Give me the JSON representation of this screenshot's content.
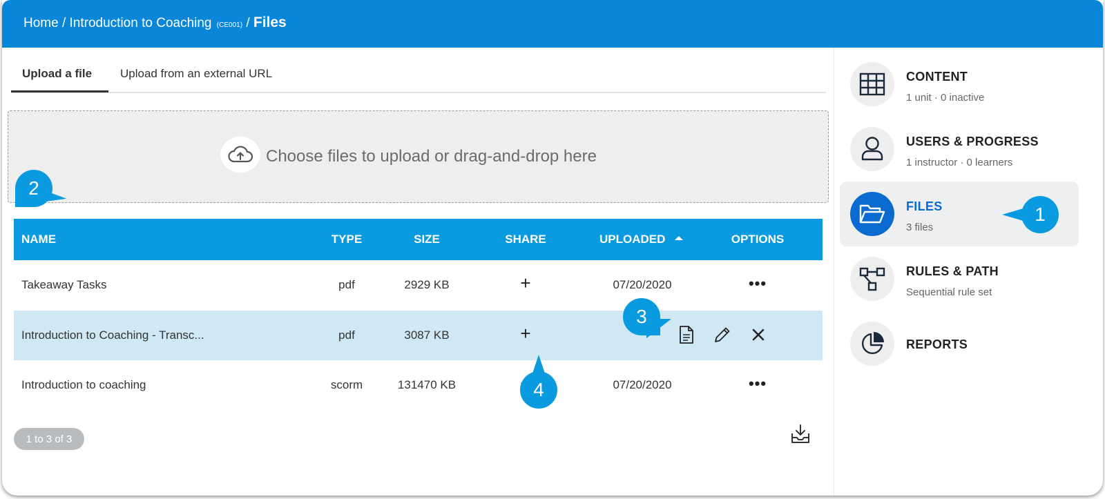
{
  "breadcrumb": {
    "home": "Home",
    "sep1": "/",
    "course": "Introduction to Coaching",
    "code": "(CE001)",
    "sep2": "/",
    "current": "Files"
  },
  "tabs": [
    {
      "label": "Upload a file",
      "active": true
    },
    {
      "label": "Upload from an external URL",
      "active": false
    }
  ],
  "dropzone": {
    "text": "Choose files to upload or drag-and-drop here",
    "icon": "cloud-upload-icon"
  },
  "table": {
    "headers": {
      "name": "NAME",
      "type": "TYPE",
      "size": "SIZE",
      "share": "SHARE",
      "uploaded": "UPLOADED",
      "options": "OPTIONS"
    },
    "sort": {
      "column": "uploaded",
      "direction": "ascending"
    },
    "rows": [
      {
        "name": "Takeaway Tasks",
        "type": "pdf",
        "size": "2929 KB",
        "share": "+",
        "uploaded": "07/20/2020",
        "options": "•••"
      },
      {
        "name": "Introduction to Coaching - Transc...",
        "type": "pdf",
        "size": "3087 KB",
        "share": "+",
        "uploaded": "",
        "options": "",
        "hover_actions": [
          "document-icon",
          "pencil-icon",
          "close-icon"
        ]
      },
      {
        "name": "Introduction to coaching",
        "type": "scorm",
        "size": "131470 KB",
        "share": "+",
        "uploaded": "07/20/2020",
        "options": "•••"
      }
    ],
    "pager": "1 to 3 of 3"
  },
  "sidebar": [
    {
      "title": "CONTENT",
      "subtitle": "1 unit · 0 inactive",
      "icon": "grid-icon",
      "active": false
    },
    {
      "title": "USERS & PROGRESS",
      "subtitle": "1 instructor · 0 learners",
      "icon": "user-icon",
      "active": false
    },
    {
      "title": "FILES",
      "subtitle": "3 files",
      "icon": "folder-open-icon",
      "active": true
    },
    {
      "title": "RULES & PATH",
      "subtitle": "Sequential rule set",
      "icon": "flow-icon",
      "active": false
    },
    {
      "title": "REPORTS",
      "subtitle": "",
      "icon": "pie-chart-icon",
      "active": false
    }
  ],
  "callouts": [
    "1",
    "2",
    "3",
    "4"
  ],
  "colors": {
    "header": "#0a86d8",
    "table_header": "#0a9ae0",
    "highlight_row": "#cfe8f3",
    "active_nav": "#0a6ad0"
  }
}
